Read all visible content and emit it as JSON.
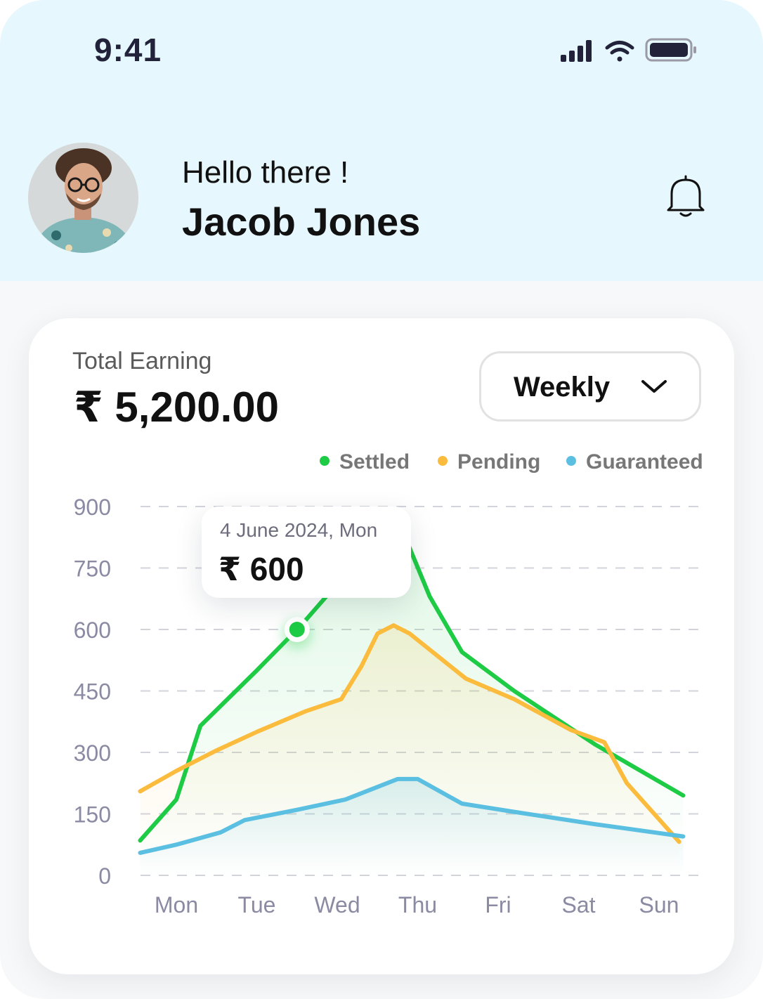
{
  "status_bar": {
    "time": "9:41"
  },
  "header": {
    "greeting": "Hello there !",
    "user_name": "Jacob Jones"
  },
  "earnings": {
    "label": "Total Earning",
    "amount": "₹ 5,200.00"
  },
  "period_select": {
    "selected": "Weekly"
  },
  "tooltip": {
    "date": "4 June 2024, Mon",
    "value": "₹ 600"
  },
  "colors": {
    "settled": "#1ecb45",
    "pending": "#fbbb3d",
    "guaranteed": "#5bbfe1",
    "header_bg": "#e6f7fe"
  },
  "chart_data": {
    "type": "line",
    "categories": [
      "Mon",
      "Tue",
      "Wed",
      "Thu",
      "Fri",
      "Sat",
      "Sun"
    ],
    "yticks": [
      0,
      150,
      300,
      450,
      600,
      750,
      900
    ],
    "ylim": [
      0,
      900
    ],
    "grid": true,
    "legend_position": "top-right",
    "x_range": [
      -0.45,
      6.3
    ],
    "series": [
      {
        "name": "Settled",
        "color": "#1ecb45",
        "fill": true,
        "points": [
          [
            -0.45,
            85
          ],
          [
            0.0,
            185
          ],
          [
            0.3,
            365
          ],
          [
            1.0,
            500
          ],
          [
            1.3,
            560
          ],
          [
            1.55,
            610
          ],
          [
            1.95,
            700
          ],
          [
            2.55,
            875
          ],
          [
            2.75,
            870
          ],
          [
            3.15,
            680
          ],
          [
            3.55,
            545
          ],
          [
            4.2,
            450
          ],
          [
            5.2,
            320
          ],
          [
            6.3,
            195
          ]
        ]
      },
      {
        "name": "Pending",
        "color": "#fbbb3d",
        "fill": true,
        "points": [
          [
            -0.45,
            205
          ],
          [
            0.0,
            255
          ],
          [
            0.5,
            305
          ],
          [
            1.0,
            350
          ],
          [
            1.6,
            400
          ],
          [
            2.05,
            430
          ],
          [
            2.3,
            510
          ],
          [
            2.5,
            590
          ],
          [
            2.7,
            610
          ],
          [
            2.9,
            590
          ],
          [
            3.6,
            480
          ],
          [
            4.2,
            430
          ],
          [
            4.9,
            355
          ],
          [
            5.32,
            325
          ],
          [
            5.6,
            225
          ],
          [
            6.25,
            82
          ]
        ]
      },
      {
        "name": "Guaranteed",
        "color": "#5bbfe1",
        "fill": true,
        "points": [
          [
            -0.45,
            55
          ],
          [
            0.0,
            75
          ],
          [
            0.55,
            105
          ],
          [
            0.85,
            135
          ],
          [
            1.5,
            160
          ],
          [
            2.1,
            185
          ],
          [
            2.75,
            235
          ],
          [
            3.0,
            235
          ],
          [
            3.55,
            175
          ],
          [
            4.2,
            155
          ],
          [
            5.2,
            125
          ],
          [
            6.3,
            95
          ]
        ]
      }
    ],
    "highlight": {
      "series": "Settled",
      "x": 1.5,
      "y": 600,
      "label": "₹ 600",
      "date": "4 June 2024, Mon"
    }
  }
}
